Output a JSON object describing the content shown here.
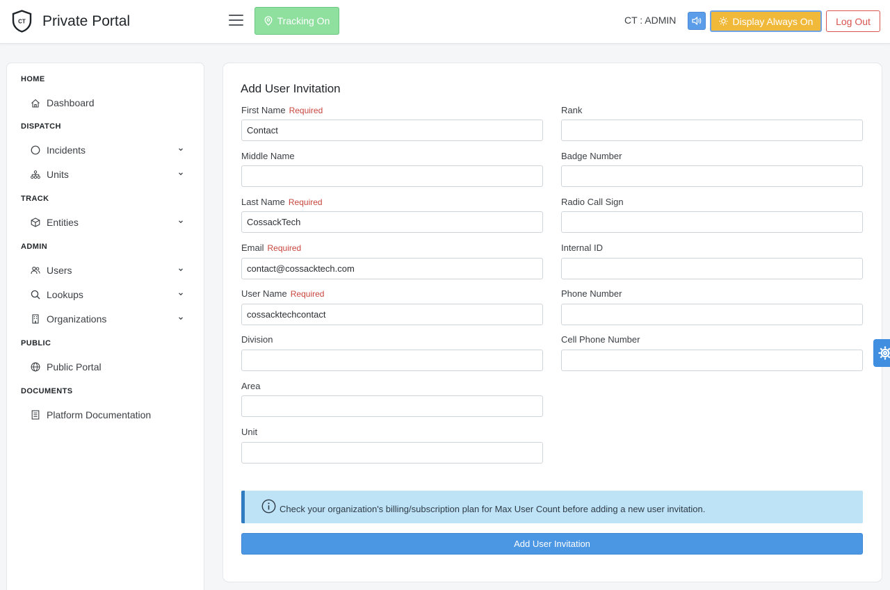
{
  "header": {
    "logo_text": "CT",
    "app_title": "Private Portal",
    "tracking_label": "Tracking On",
    "user_label": "CT : ADMIN",
    "display_label": "Display Always On",
    "logout_label": "Log Out",
    "icons": [
      "shield-logo-icon",
      "menu-icon",
      "location-pin-icon",
      "speaker-icon",
      "sun-icon"
    ],
    "colors": {
      "tracking": "#8fdf9f",
      "sound": "#5b9de8",
      "display": "#f1b93a",
      "logout": "#d9534f"
    }
  },
  "sidebar": {
    "sections": {
      "home": "HOME",
      "dispatch": "DISPATCH",
      "track": "TRACK",
      "admin": "ADMIN",
      "public": "PUBLIC",
      "documents": "DOCUMENTS"
    },
    "items": {
      "dashboard": "Dashboard",
      "incidents": "Incidents",
      "units": "Units",
      "entities": "Entities",
      "users": "Users",
      "lookups": "Lookups",
      "organizations": "Organizations",
      "public_portal": "Public Portal",
      "platform_documentation": "Platform Documentation"
    }
  },
  "form": {
    "title": "Add User Invitation",
    "required_text": "Required",
    "first_name": {
      "label": "First Name",
      "value": "Contact"
    },
    "middle_name": {
      "label": "Middle Name",
      "value": ""
    },
    "last_name": {
      "label": "Last Name",
      "value": "CossackTech"
    },
    "email": {
      "label": "Email",
      "value": "contact@cossacktech.com"
    },
    "user_name": {
      "label": "User Name",
      "value": "cossacktechcontact"
    },
    "division": {
      "label": "Division",
      "value": ""
    },
    "area": {
      "label": "Area",
      "value": ""
    },
    "unit": {
      "label": "Unit",
      "value": ""
    },
    "rank": {
      "label": "Rank",
      "value": ""
    },
    "badge_number": {
      "label": "Badge Number",
      "value": ""
    },
    "radio_call_sign": {
      "label": "Radio Call Sign",
      "value": ""
    },
    "internal_id": {
      "label": "Internal ID",
      "value": ""
    },
    "phone_number": {
      "label": "Phone Number",
      "value": ""
    },
    "cell_phone_number": {
      "label": "Cell Phone Number",
      "value": ""
    },
    "alert_text": "Check your organization's billing/subscription plan for Max User Count before adding a new user invitation.",
    "submit_label": "Add User Invitation"
  }
}
